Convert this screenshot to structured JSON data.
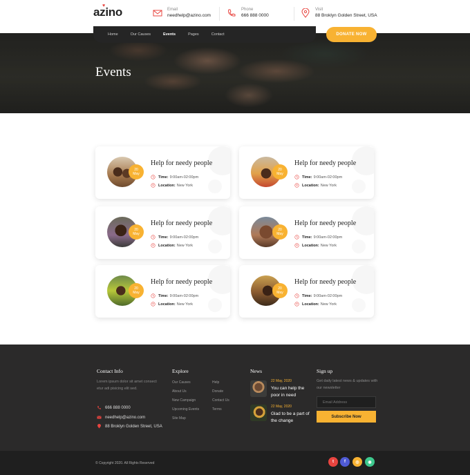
{
  "header": {
    "logo": "azino",
    "email": {
      "label": "Email",
      "value": "needhelp@azino.com"
    },
    "phone": {
      "label": "Phone",
      "value": "666 888 0000"
    },
    "visit": {
      "label": "Visit",
      "value": "88 Broklyn Golden Street, USA"
    }
  },
  "nav": {
    "items": [
      "Home",
      "Our Causes",
      "Events",
      "Pages",
      "Contact"
    ],
    "active": "Events",
    "donate_label": "DONATE NOW"
  },
  "hero": {
    "title": "Events"
  },
  "events": [
    {
      "title": "Help for needy people",
      "day": "20",
      "month": "May",
      "time_label": "Time:",
      "time": "9:00am-02:00pm",
      "location_label": "Location:",
      "location": "New York"
    },
    {
      "title": "Help for needy people",
      "day": "20",
      "month": "May",
      "time_label": "Time:",
      "time": "9:00am-02:00pm",
      "location_label": "Location:",
      "location": "New York"
    },
    {
      "title": "Help for needy people",
      "day": "20",
      "month": "May",
      "time_label": "Time:",
      "time": "9:00am-02:00pm",
      "location_label": "Location:",
      "location": "New York"
    },
    {
      "title": "Help for needy people",
      "day": "20",
      "month": "May",
      "time_label": "Time:",
      "time": "9:00am-02:00pm",
      "location_label": "Location:",
      "location": "New York"
    },
    {
      "title": "Help for needy people",
      "day": "20",
      "month": "May",
      "time_label": "Time:",
      "time": "9:00am-02:00pm",
      "location_label": "Location:",
      "location": "New York"
    },
    {
      "title": "Help for needy people",
      "day": "20",
      "month": "May",
      "time_label": "Time:",
      "time": "9:00am-02:00pm",
      "location_label": "Location:",
      "location": "New York"
    }
  ],
  "footer": {
    "contact": {
      "heading": "Contact Info",
      "text": "Lorem ipsum dolor sit amet consect etur adi pisicing elit sed.",
      "phone": "666 888 0000",
      "email": "needhelp@azino.com",
      "address": "88 Broklyn Golden Street, USA"
    },
    "explore": {
      "heading": "Explore",
      "col1": [
        "Our Causes",
        "About Us",
        "New Campaign",
        "Upcoming Events",
        "Site Map"
      ],
      "col2": [
        "Help",
        "Donate",
        "Contact Us",
        "Terms"
      ]
    },
    "news": {
      "heading": "News",
      "items": [
        {
          "date": "22 May, 2020",
          "title": "You can help the poor in need"
        },
        {
          "date": "22 May, 2020",
          "title": "Glad to be a part of the change"
        }
      ]
    },
    "signup": {
      "heading": "Sign up",
      "text": "Get daily latest news & updates with our newsletter",
      "placeholder": "Email Address",
      "button": "Subscribe Now"
    },
    "copyright": "© Copyright 2020. All Rights Reserved",
    "social": [
      {
        "icon": "twitter-icon",
        "glyph": "t",
        "color": "#e8443f"
      },
      {
        "icon": "facebook-icon",
        "glyph": "f",
        "color": "#4f5bd5"
      },
      {
        "icon": "instagram-icon",
        "glyph": "◎",
        "color": "#f8b232"
      },
      {
        "icon": "pinterest-icon",
        "glyph": "◉",
        "color": "#3ec98e"
      }
    ]
  },
  "colors": {
    "accent": "#f8b232",
    "red": "#e8443f",
    "dark": "#2b2a2a"
  }
}
